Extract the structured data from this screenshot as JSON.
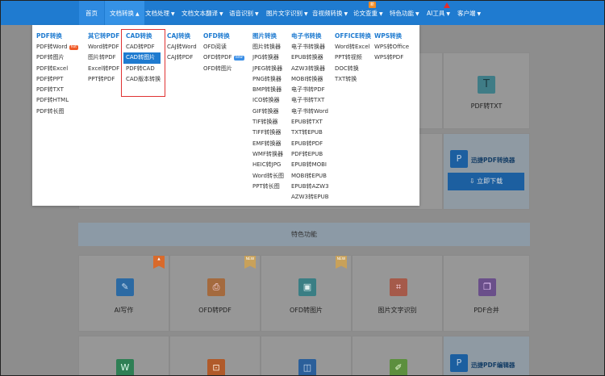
{
  "nav": {
    "items": [
      {
        "label": "首页",
        "caret": ""
      },
      {
        "label": "文档转换",
        "caret": "▲"
      },
      {
        "label": "文档处理",
        "caret": "▼"
      },
      {
        "label": "文档文本翻译",
        "caret": "▼"
      },
      {
        "label": "语音识别",
        "caret": "▼"
      },
      {
        "label": "图片文字识别",
        "caret": "▼"
      },
      {
        "label": "音视频转换",
        "caret": "▼"
      },
      {
        "label": "论文查重",
        "caret": "▼"
      },
      {
        "label": "特色功能",
        "caret": "▼"
      },
      {
        "label": "AI工具",
        "caret": "▼"
      },
      {
        "label": "客户端",
        "caret": "▼"
      }
    ],
    "new_badge": "新"
  },
  "mega_menu": {
    "columns": [
      {
        "head": "PDF转换",
        "items": [
          "PDF转Word",
          "PDF转图片",
          "PDF转Excel",
          "PDF转PPT",
          "PDF转TXT",
          "PDF转HTML",
          "PDF转长图"
        ]
      },
      {
        "head": "其它转PDF",
        "items": [
          "Word转PDF",
          "图片转PDF",
          "Excel转PDF",
          "PPT转PDF"
        ]
      },
      {
        "head": "CAD转换",
        "items": [
          "CAD转PDF",
          "CAD转图片",
          "PDF转CAD",
          "CAD版本转换"
        ]
      },
      {
        "head": "CAJ转换",
        "items": [
          "CAJ转Word",
          "CAJ转PDF"
        ]
      },
      {
        "head": "OFD转换",
        "items": [
          "OFD阅读",
          "OFD转PDF",
          "OFD转图片"
        ]
      },
      {
        "head": "图片转换",
        "items": [
          "图片转换器",
          "JPG转换器",
          "JPEG转换器",
          "PNG转换器",
          "BMP转换器",
          "ICO转换器",
          "GIF转换器",
          "TIF转换器",
          "TIFF转换器",
          "EMF转换器",
          "WMF转换器",
          "HEIC转JPG",
          "Word转长图",
          "PPT转长图"
        ]
      },
      {
        "head": "电子书转换",
        "items": [
          "电子书转换器",
          "EPUB转换器",
          "AZW3转换器",
          "MOBI转换器",
          "电子书转PDF",
          "电子书转TXT",
          "电子书转Word",
          "EPUB转TXT",
          "TXT转EPUB",
          "EPUB转PDF",
          "PDF转EPUB",
          "EPUB转MOBI",
          "MOBI转EPUB",
          "EPUB转AZW3",
          "AZW3转EPUB"
        ]
      },
      {
        "head": "OFFICE转换",
        "items": [
          "Word转Excel",
          "PPT转视频",
          "DOC转换",
          "TXT转换"
        ]
      },
      {
        "head": "WPS转换",
        "items": [
          "WPS转Office",
          "WPS转PDF"
        ]
      }
    ],
    "hot_tag": "hot",
    "new_tag": "new"
  },
  "background": {
    "pdf_txt_label": "PDF转TXT",
    "promo_title": "迅捷PDF转换器",
    "promo_button": "立即下载",
    "section_title": "特色功能",
    "feature_cards": [
      "AI写作",
      "OFD转PDF",
      "OFD转图片",
      "图片文字识别",
      "PDF合并"
    ],
    "card_badge_new": "NEW",
    "promo2_title": "迅捷PDF编辑器"
  },
  "colors": {
    "nav_bg": "#1f7bd0",
    "accent": "#1f7bd0",
    "highlight": "#e03232"
  }
}
